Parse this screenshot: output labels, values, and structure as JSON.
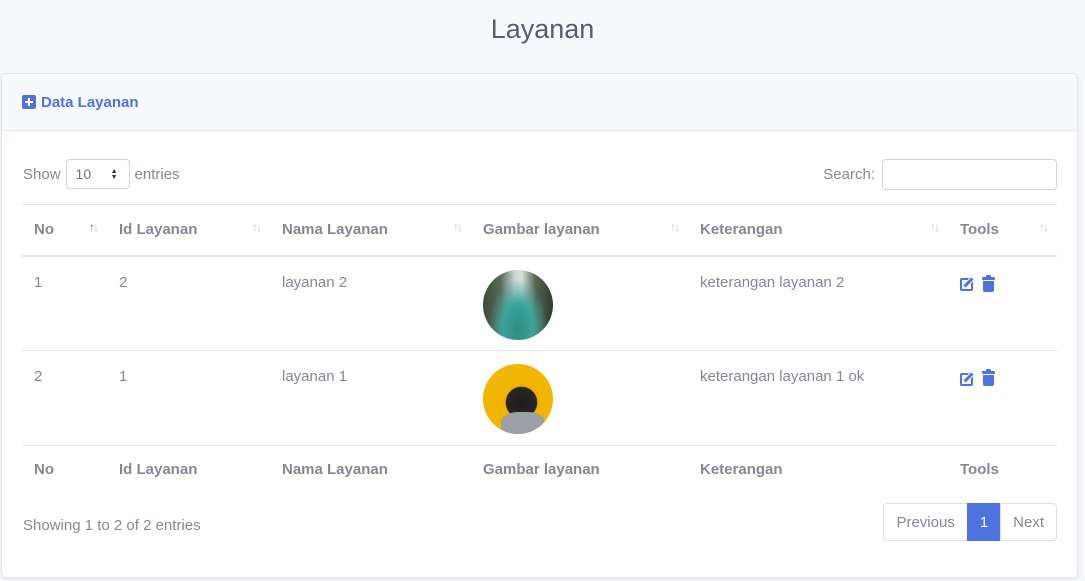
{
  "page": {
    "title": "Layanan"
  },
  "card": {
    "header_title": "Data Layanan"
  },
  "length": {
    "show_label": "Show",
    "selected": "10",
    "entries_label": "entries"
  },
  "search": {
    "label": "Search:",
    "value": ""
  },
  "table": {
    "columns": [
      "No",
      "Id Layanan",
      "Nama Layanan",
      "Gambar layanan",
      "Keterangan",
      "Tools"
    ],
    "rows": [
      {
        "no": "1",
        "id": "2",
        "nama": "layanan 2",
        "image": "mountain-lake-photo",
        "keterangan": "keterangan layanan 2"
      },
      {
        "no": "2",
        "id": "1",
        "nama": "layanan 1",
        "image": "pug-dog-photo",
        "keterangan": "keterangan layanan 1 ok"
      }
    ]
  },
  "info": "Showing 1 to 2 of 2 entries",
  "pagination": {
    "previous": "Previous",
    "current": "1",
    "next": "Next"
  },
  "colors": {
    "primary": "#4e73df",
    "text": "#858796",
    "border": "#e3e6f0"
  }
}
